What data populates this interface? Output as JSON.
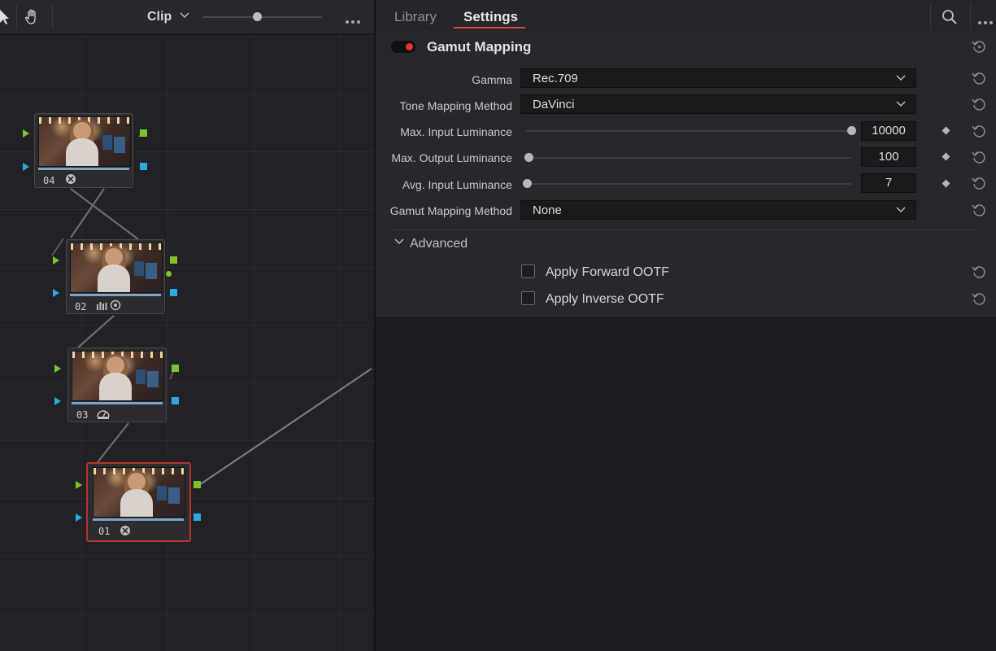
{
  "node_editor": {
    "toolbar": {
      "clip_label": "Clip",
      "zoom_level": 0.45
    },
    "nodes": [
      {
        "number": "04",
        "icon": "color-managed-icon"
      },
      {
        "number": "02",
        "icon": "scope-icon"
      },
      {
        "number": "03",
        "icon": "hdr-icon"
      },
      {
        "number": "01",
        "icon": "color-managed-icon"
      }
    ]
  },
  "settings_panel": {
    "tabs": [
      {
        "label": "Library",
        "active": false
      },
      {
        "label": "Settings",
        "active": true
      }
    ],
    "section": {
      "title": "Gamut Mapping",
      "enabled": true,
      "accent_color": "#e5352b"
    },
    "fields": {
      "gamma": {
        "label": "Gamma",
        "value": "Rec.709"
      },
      "tone_mapping_method": {
        "label": "Tone Mapping Method",
        "value": "DaVinci"
      },
      "max_input_luminance": {
        "label": "Max. Input Luminance",
        "value": "10000",
        "slider_fraction": 1.0
      },
      "max_output_luminance": {
        "label": "Max. Output Luminance",
        "value": "100",
        "slider_fraction": 0.0
      },
      "avg_input_luminance": {
        "label": "Avg. Input Luminance",
        "value": "7",
        "slider_fraction": 0.0
      },
      "gamut_mapping_method": {
        "label": "Gamut Mapping Method",
        "value": "None"
      }
    },
    "advanced": {
      "label": "Advanced",
      "expanded": true,
      "options": [
        {
          "label": "Apply Forward OOTF",
          "checked": false
        },
        {
          "label": "Apply Inverse OOTF",
          "checked": false
        }
      ]
    }
  }
}
